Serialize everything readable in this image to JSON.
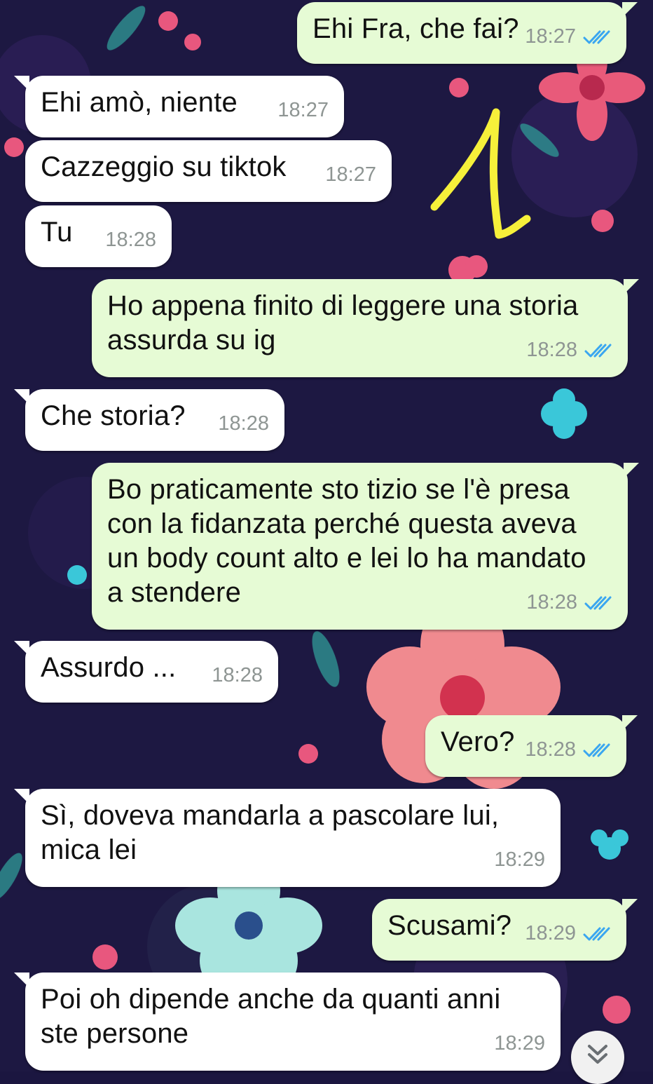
{
  "chat": {
    "messages": [
      {
        "dir": "out",
        "text": "Ehi Fra, che fai?",
        "time": "18:27",
        "read": true
      },
      {
        "dir": "in",
        "text": "Ehi amò, niente",
        "time": "18:27"
      },
      {
        "dir": "in",
        "text": "Cazzeggio su tiktok",
        "time": "18:27"
      },
      {
        "dir": "in",
        "text": "Tu",
        "time": "18:28"
      },
      {
        "dir": "out",
        "text": "Ho appena finito di leggere una storia\nassurda su ig",
        "time": "18:28",
        "read": true
      },
      {
        "dir": "in",
        "text": "Che storia?",
        "time": "18:28"
      },
      {
        "dir": "out",
        "text": "Bo praticamente sto tizio se l'è presa\ncon la fidanzata perché questa aveva\nun body count alto e lei lo ha mandato\na stendere",
        "time": "18:28",
        "read": true
      },
      {
        "dir": "in",
        "text": "Assurdo ...",
        "time": "18:28"
      },
      {
        "dir": "out",
        "text": "Vero?",
        "time": "18:28",
        "read": true
      },
      {
        "dir": "in",
        "text": "Sì, doveva mandarla a pascolare lui,\nmica lei",
        "time": "18:29"
      },
      {
        "dir": "out",
        "text": "Scusami?",
        "time": "18:29",
        "read": true
      },
      {
        "dir": "in",
        "text": "Poi oh dipende anche da quanti anni\nste persone",
        "time": "18:29"
      }
    ]
  },
  "colors": {
    "incoming_bubble": "#ffffff",
    "outgoing_bubble": "#e6fbd5",
    "read_ticks": "#3aa6f0",
    "annotation": "#f6f03a"
  },
  "icons": {
    "read_receipt": "double-check-icon",
    "scroll_down": "double-chevron-down-icon"
  }
}
